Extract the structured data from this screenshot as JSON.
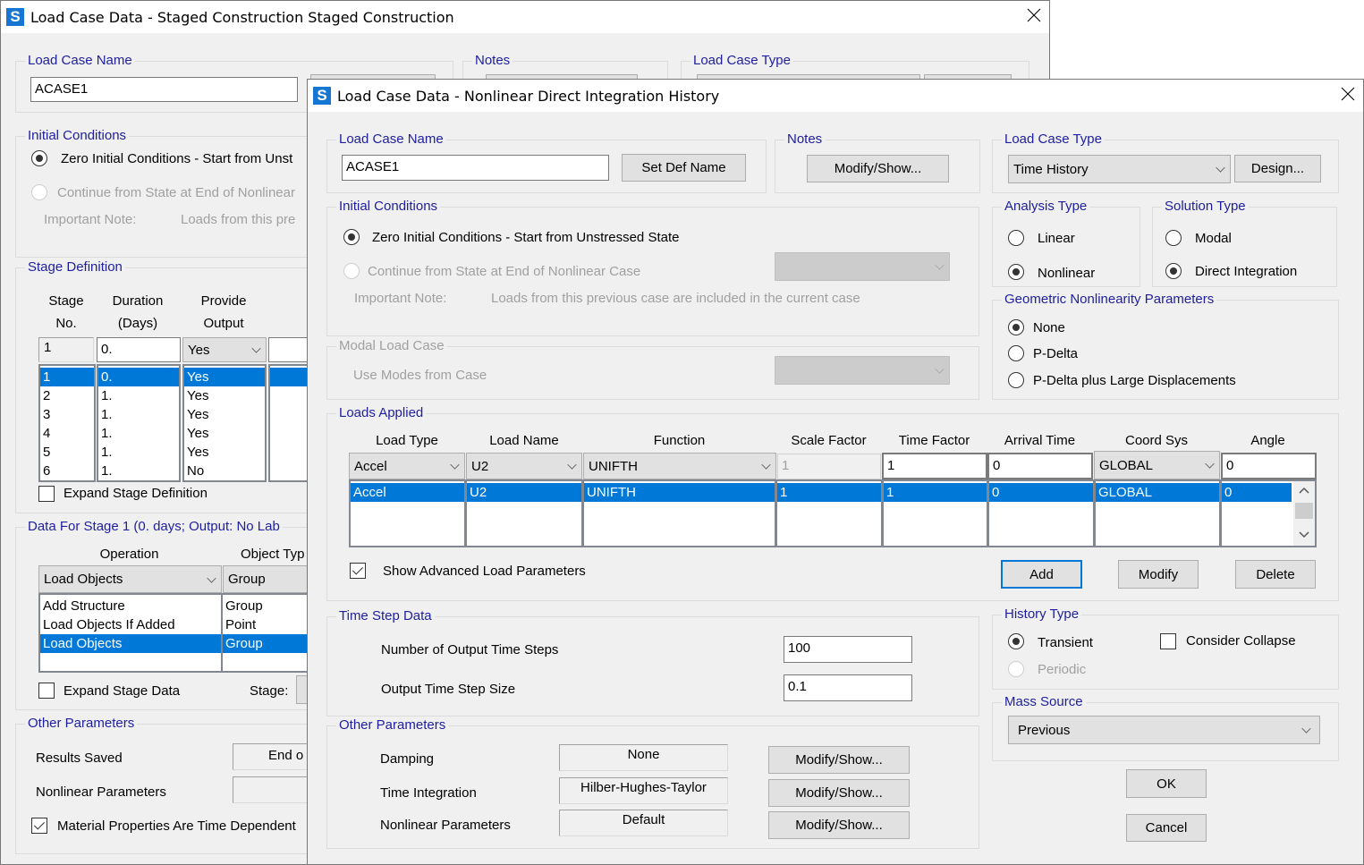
{
  "back_dialog": {
    "title": "Load Case Data - Staged Construction Staged Construction",
    "load_case_name": {
      "label": "Load Case Name",
      "value": "ACASE1"
    },
    "notes": {
      "label": "Notes"
    },
    "load_case_type": {
      "label": "Load Case Type"
    },
    "initial_conditions": {
      "label": "Initial Conditions",
      "zero_option": "Zero Initial Conditions - Start from Unst",
      "continue_option": "Continue from State at End of Nonlinear",
      "note_label": "Important Note:",
      "note_text": "Loads from this pre"
    },
    "stage_definition": {
      "label": "Stage Definition",
      "headers": {
        "stage_top": "Stage",
        "stage_bottom": "No.",
        "duration_top": "Duration",
        "duration_bottom": "(Days)",
        "output_top": "Provide",
        "output_bottom": "Output"
      },
      "edit_row": {
        "stage": "1",
        "duration": "0.",
        "output": "Yes"
      },
      "rows": [
        {
          "stage": "1",
          "duration": "0.",
          "output": "Yes"
        },
        {
          "stage": "2",
          "duration": "1.",
          "output": "Yes"
        },
        {
          "stage": "3",
          "duration": "1.",
          "output": "Yes"
        },
        {
          "stage": "4",
          "duration": "1.",
          "output": "Yes"
        },
        {
          "stage": "5",
          "duration": "1.",
          "output": "Yes"
        },
        {
          "stage": "6",
          "duration": "1.",
          "output": "No"
        }
      ],
      "expand_label": "Expand Stage Definition"
    },
    "stage_data": {
      "label": "Data For Stage 1  (0. days;  Output: No Lab",
      "operation_header": "Operation",
      "object_type_header": "Object Typ",
      "operation_value": "Load Objects",
      "object_type_value": "Group",
      "operations": [
        "Add Structure",
        "Load Objects If Added",
        "Load Objects"
      ],
      "object_types": [
        "Group",
        "Point",
        "Group"
      ],
      "expand_label": "Expand Stage Data",
      "stage_label": "Stage:"
    },
    "other_parameters": {
      "label": "Other Parameters",
      "results_saved_label": "Results Saved",
      "results_saved_value": "End o",
      "nonlinear_label": "Nonlinear Parameters",
      "material_label": "Material Properties Are Time Dependent"
    }
  },
  "front_dialog": {
    "title": "Load Case Data - Nonlinear Direct Integration History",
    "load_case_name": {
      "label": "Load Case Name",
      "value": "ACASE1",
      "set_def_button": "Set Def Name"
    },
    "notes": {
      "label": "Notes",
      "button": "Modify/Show..."
    },
    "load_case_type": {
      "label": "Load Case Type",
      "value": "Time History",
      "design_button": "Design..."
    },
    "initial_conditions": {
      "label": "Initial Conditions",
      "zero_option": "Zero Initial Conditions - Start from Unstressed State",
      "continue_option": "Continue from State at End of Nonlinear Case",
      "note_label": "Important Note:",
      "note_text": "Loads from this previous case are included in the current case"
    },
    "modal_load_case": {
      "label": "Modal Load Case",
      "use_modes_label": "Use Modes from Case"
    },
    "analysis_type": {
      "label": "Analysis Type",
      "options": [
        "Linear",
        "Nonlinear"
      ],
      "selected": "Nonlinear"
    },
    "solution_type": {
      "label": "Solution Type",
      "options": [
        "Modal",
        "Direct Integration"
      ],
      "selected": "Direct Integration"
    },
    "geometric_nonlinearity": {
      "label": "Geometric Nonlinearity Parameters",
      "options": [
        "None",
        "P-Delta",
        "P-Delta plus Large Displacements"
      ],
      "selected": "None"
    },
    "loads_applied": {
      "label": "Loads Applied",
      "headers": [
        "Load Type",
        "Load Name",
        "Function",
        "Scale Factor",
        "Time Factor",
        "Arrival Time",
        "Coord Sys",
        "Angle"
      ],
      "edit_row": [
        "Accel",
        "U2",
        "UNIFTH",
        "1",
        "1",
        "0",
        "GLOBAL",
        "0"
      ],
      "rows": [
        [
          "Accel",
          "U2",
          "UNIFTH",
          "1",
          "1",
          "0",
          "GLOBAL",
          "0"
        ]
      ],
      "show_advanced_label": "Show Advanced Load Parameters",
      "add_button": "Add",
      "modify_button": "Modify",
      "delete_button": "Delete"
    },
    "time_step_data": {
      "label": "Time Step Data",
      "num_steps_label": "Number of Output Time Steps",
      "num_steps_value": "100",
      "step_size_label": "Output Time Step Size",
      "step_size_value": "0.1"
    },
    "other_parameters": {
      "label": "Other Parameters",
      "damping_label": "Damping",
      "damping_value": "None",
      "time_integration_label": "Time Integration",
      "time_integration_value": "Hilber-Hughes-Taylor",
      "nonlinear_label": "Nonlinear Parameters",
      "nonlinear_value": "Default",
      "modify_button": "Modify/Show..."
    },
    "history_type": {
      "label": "History Type",
      "options": [
        "Transient",
        "Periodic"
      ],
      "selected": "Transient",
      "consider_collapse_label": "Consider Collapse"
    },
    "mass_source": {
      "label": "Mass Source",
      "value": "Previous"
    },
    "ok_button": "OK",
    "cancel_button": "Cancel"
  },
  "colors": {
    "group_label": "#1e1e9e",
    "selection": "#0078d7",
    "disabled": "#a0a0a0",
    "app_icon": "#1677d2"
  }
}
